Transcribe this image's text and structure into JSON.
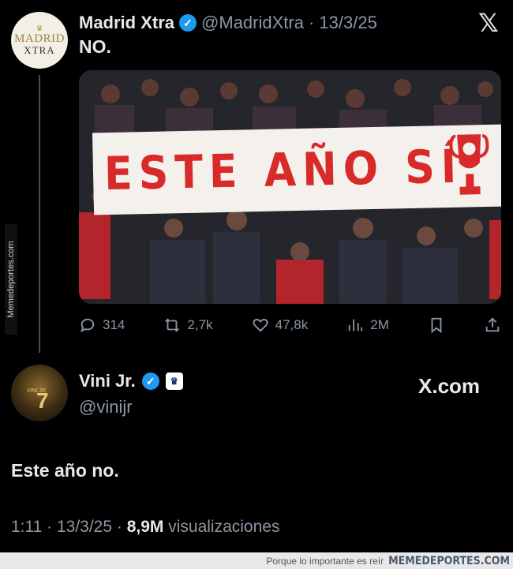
{
  "tweet1": {
    "avatar_text_line1": "MADRID",
    "avatar_text_line2": "XTRA",
    "display_name": "Madrid Xtra",
    "handle": "@MadridXtra",
    "date": "· 13/3/25",
    "text": "NO.",
    "media": {
      "banner_text": "ESTE AÑO SÍ"
    },
    "actions": {
      "replies": "314",
      "reposts": "2,7k",
      "likes": "47,8k",
      "views": "2M"
    }
  },
  "side_watermark": "Memedeportes.com",
  "tweet2": {
    "avatar_number": "7",
    "avatar_text": "VINI JR",
    "display_name": "Vini Jr.",
    "handle": "@vinijr",
    "source_label": "X.com",
    "text": "Este año no.",
    "meta_time": "1:11 · 13/3/25 · ",
    "meta_views_count": "8,9M",
    "meta_views_label": " visualizaciones"
  },
  "footer": {
    "tagline": "Porque lo importante es reír",
    "brand": "MEMEDEPORTES.COM"
  },
  "colors": {
    "background": "#000000",
    "verified_blue": "#1d9bf0",
    "muted_text": "#8b98a5",
    "banner_red": "#d92a2a"
  }
}
